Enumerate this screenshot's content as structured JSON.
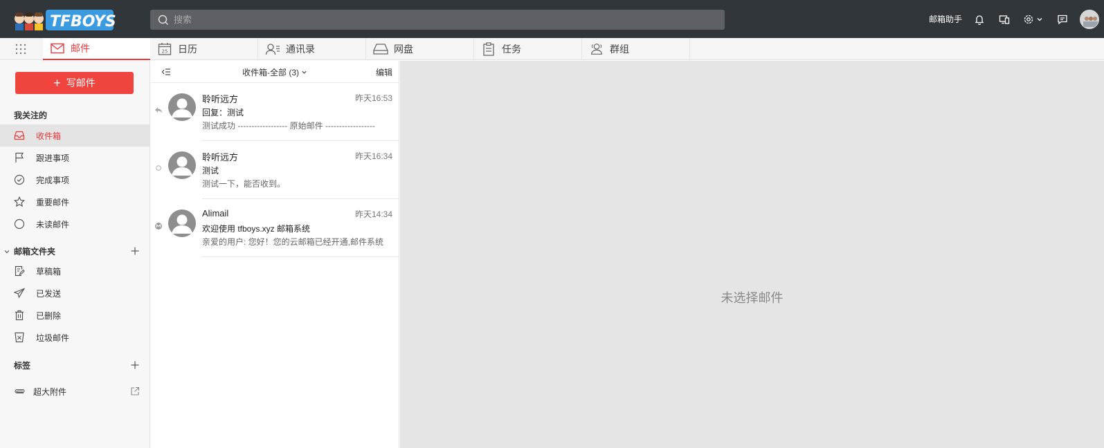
{
  "header": {
    "logo_text": "TFBOYS",
    "search_placeholder": "搜索",
    "assistant_label": "邮箱助手"
  },
  "tabs": [
    {
      "label": "邮件",
      "icon": "mail-icon",
      "active": true
    },
    {
      "label": "日历",
      "icon": "calendar-icon",
      "badge": "25"
    },
    {
      "label": "通讯录",
      "icon": "contacts-icon"
    },
    {
      "label": "网盘",
      "icon": "drive-icon"
    },
    {
      "label": "任务",
      "icon": "task-icon"
    },
    {
      "label": "群组",
      "icon": "group-icon"
    }
  ],
  "sidebar": {
    "compose_label": "写邮件",
    "favorites_title": "我关注的",
    "favorites": [
      {
        "label": "收件箱",
        "icon": "inbox-icon",
        "active": true
      },
      {
        "label": "跟进事项",
        "icon": "flag-icon"
      },
      {
        "label": "完成事项",
        "icon": "check-circle-icon"
      },
      {
        "label": "重要邮件",
        "icon": "star-icon"
      },
      {
        "label": "未读邮件",
        "icon": "circle-icon"
      }
    ],
    "folders_title": "邮箱文件夹",
    "folders": [
      {
        "label": "草稿箱",
        "icon": "draft-icon"
      },
      {
        "label": "已发送",
        "icon": "send-icon"
      },
      {
        "label": "已删除",
        "icon": "trash-icon"
      },
      {
        "label": "垃圾邮件",
        "icon": "spam-icon"
      }
    ],
    "tags_title": "标签",
    "attachments_label": "超大附件"
  },
  "maillist": {
    "filter_label": "收件箱-全部 (3)",
    "edit_label": "编辑",
    "mails": [
      {
        "sender": "聆听远方",
        "time": "昨天16:53",
        "subject": "回复：测试",
        "preview": "测试成功 ------------------ 原始邮件 ------------------",
        "state": "replied-icon"
      },
      {
        "sender": "聆听远方",
        "time": "昨天16:34",
        "subject": "测试",
        "preview": "测试一下，能否收到。",
        "state": "unread-dot-icon"
      },
      {
        "sender": "Alimail",
        "time": "昨天14:34",
        "subject": "欢迎使用 tfboys.xyz 邮箱系统",
        "preview": "亲爱的用户:     您好！您的云邮箱已经开通,邮件系统",
        "state": "system-icon"
      }
    ]
  },
  "reading": {
    "empty_label": "未选择邮件"
  },
  "colors": {
    "accent": "#e8393b",
    "topbar": "#31363b"
  }
}
